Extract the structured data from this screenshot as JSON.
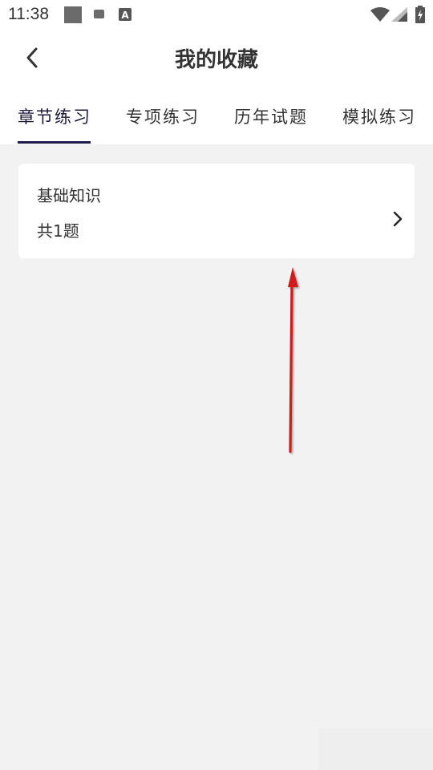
{
  "status_bar": {
    "time": "11:38"
  },
  "header": {
    "title": "我的收藏",
    "back_icon": "chevron-left-icon"
  },
  "tabs": [
    {
      "label": "章节练习",
      "active": true
    },
    {
      "label": "专项练习",
      "active": false
    },
    {
      "label": "历年试题",
      "active": false
    },
    {
      "label": "模拟练习",
      "active": false
    }
  ],
  "list": [
    {
      "title": "基础知识",
      "count": "共1题",
      "icon": "chevron-right-icon"
    }
  ],
  "colors": {
    "tab_indicator": "#1e1a4d",
    "background": "#f2f2f2",
    "annotation_arrow": "#d11a1a"
  }
}
